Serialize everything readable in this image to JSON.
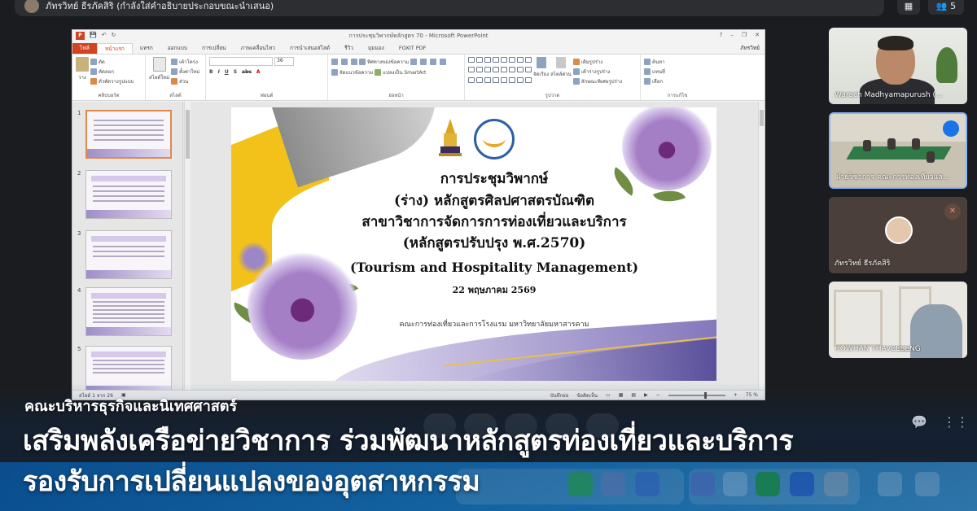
{
  "meeting": {
    "presenter_banner": "ภัทรวิทย์ ธีรภัคสิริ (กำลังใส่คำอธิบายประกอบขณะนำเสนอ)",
    "participant_count": "5"
  },
  "powerpoint": {
    "window_title": "การประชุมวิพากษ์หลักสูตร 70 - Microsoft PowerPoint",
    "user": "ภัทรวิทย์",
    "tabs": [
      "ไฟล์",
      "หน้าแรก",
      "แทรก",
      "ออกแบบ",
      "การเปลี่ยน",
      "ภาพเคลื่อนไหว",
      "การนำเสนอสไลด์",
      "รีวิว",
      "มุมมอง",
      "FOXIT PDF"
    ],
    "active_tab": "หน้าแรก",
    "ribbon": {
      "clipboard": {
        "label": "คลิปบอร์ด",
        "paste": "วาง",
        "cut": "ตัด",
        "copy": "คัดลอก",
        "format_painter": "ตัวคัดวางรูปแบบ"
      },
      "slides": {
        "label": "สไลด์",
        "new_slide": "สไลด์ใหม่",
        "layout": "เค้าโครง",
        "reset": "ตั้งค่าใหม่",
        "section": "ส่วน"
      },
      "font": {
        "label": "ฟอนต์",
        "size": "36"
      },
      "paragraph": {
        "label": "ย่อหน้า",
        "text_direction": "ทิศทางของข้อความ",
        "align_text": "จัดแนวข้อความ",
        "smartart": "แปลงเป็น SmartArt"
      },
      "drawing": {
        "label": "รูปวาด",
        "arrange": "จัดเรียง",
        "quick_styles": "สไตล์ด่วน",
        "fill": "เติมรูปร่าง",
        "outline": "เค้าร่างรูปร่าง",
        "effects": "ลักษณะพิเศษรูปร่าง"
      },
      "editing": {
        "label": "การแก้ไข",
        "find": "ค้นหา",
        "replace": "แทนที่",
        "select": "เลือก"
      }
    },
    "slide": {
      "line1": "การประชุมวิพากษ์",
      "line2": "(ร่าง) หลักสูตรศิลปศาสตรบัณฑิต",
      "line3": "สาขาวิชาการจัดการการท่องเที่ยวและบริการ",
      "line4": "(หลักสูตรปรับปรุง พ.ศ.2570)",
      "line5": "(Tourism and Hospitality Management)",
      "date": "22 พฤษภาคม 2569",
      "faculty": "คณะการท่องเที่ยวและการโรงแรม มหาวิทยาลัยมหาสารคาม"
    },
    "thumbnail_numbers": [
      "1",
      "2",
      "3",
      "4",
      "5"
    ],
    "status": {
      "slide_info": "สไลด์ 1 จาก 26",
      "notes": "บันทึกย่อ",
      "comments": "ข้อคิดเห็น",
      "zoom": "75 %"
    }
  },
  "participants": [
    {
      "name": "Warach Madhyamapurush (..."
    },
    {
      "name": "ฝ่ายวิชาการ คณะการท่องเที่ยวแล..."
    },
    {
      "name": "ภัทรวิทย์ ธีรภัคสิริ"
    },
    {
      "name": "HOWHAN THAVEESENG"
    }
  ],
  "overlay": {
    "org": "คณะบริหารธุรกิจและนิเทศศาสตร์",
    "headline_line1": "เสริมพลังเครือข่ายวิชาการ ร่วมพัฒนาหลักสูตรท่องเที่ยวและบริการ",
    "headline_line2": "รองรับการเปลี่ยนแปลงของอุตสาหกรรม"
  }
}
